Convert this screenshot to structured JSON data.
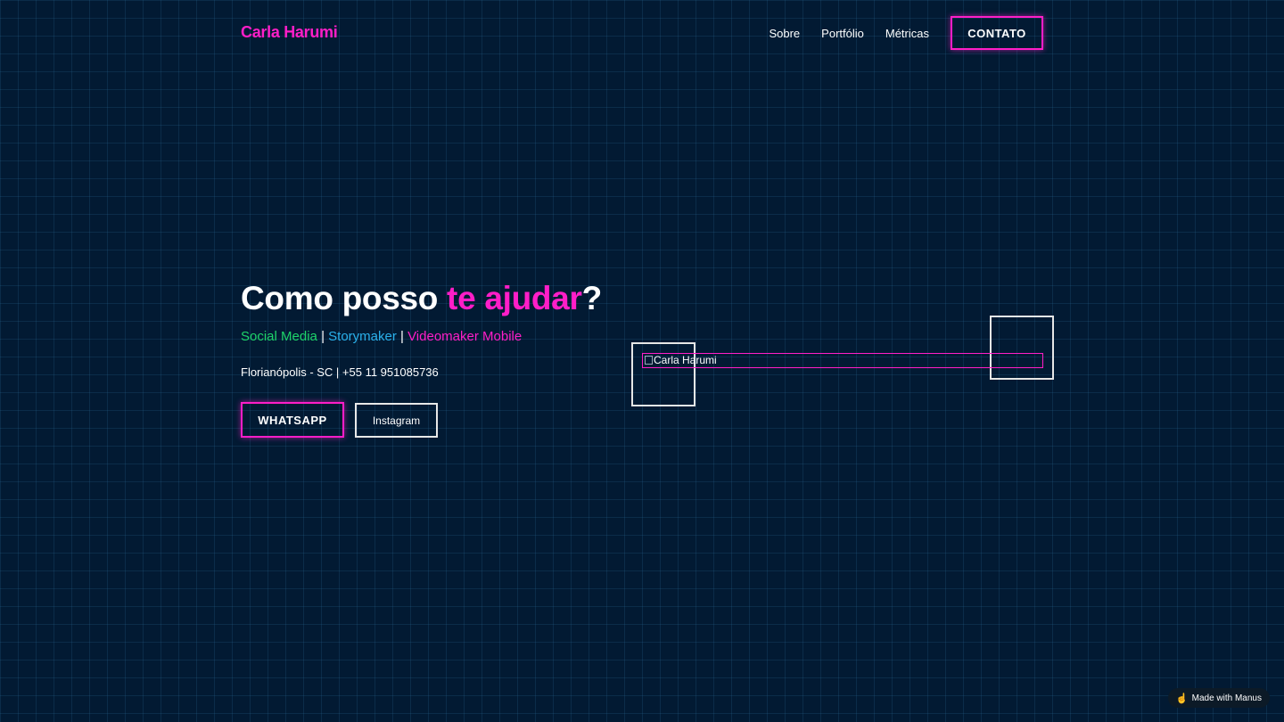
{
  "nav": {
    "logo": "Carla Harumi",
    "links": [
      "Sobre",
      "Portfólio",
      "Métricas"
    ],
    "contact_label": "CONTATO"
  },
  "hero": {
    "title_prefix": "Como posso ",
    "title_accent": "te ajudar",
    "title_suffix": "?",
    "roles": {
      "social": "Social Media",
      "story": "Storymaker",
      "video": "Videomaker Mobile",
      "separator": "|"
    },
    "location": "Florianópolis - SC | +55 11 951085736",
    "whatsapp_label": "WHATSAPP",
    "instagram_label": "Instagram"
  },
  "image": {
    "alt": "Carla Harumi"
  },
  "badge": {
    "label": "Made with Manus",
    "icon": "hand-pointer-icon"
  },
  "colors": {
    "background": "#021a33",
    "accent_pink": "#ff1ec8",
    "accent_green": "#1ed46a",
    "accent_blue": "#2ab0ea"
  }
}
